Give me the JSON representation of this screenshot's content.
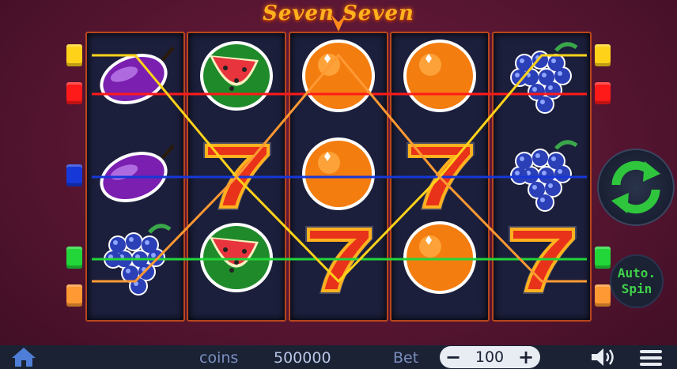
{
  "title": "Seven Seven",
  "reels": [
    [
      "plum",
      "plum",
      "grapes"
    ],
    [
      "watermelon",
      "seven",
      "watermelon"
    ],
    [
      "orange",
      "orange",
      "seven"
    ],
    [
      "orange",
      "seven",
      "orange"
    ],
    [
      "grapes",
      "grapes",
      "seven"
    ]
  ],
  "paylines": [
    {
      "color": "#ff1a1a",
      "rows": [
        0,
        0,
        0,
        0,
        0
      ]
    },
    {
      "color": "#1638d8",
      "rows": [
        1,
        1,
        1,
        1,
        1
      ]
    },
    {
      "color": "#22d63a",
      "rows": [
        2,
        2,
        2,
        2,
        2
      ]
    },
    {
      "color": "#ffd21a",
      "rows": [
        0,
        1,
        2,
        1,
        0
      ]
    },
    {
      "color": "#ff9933",
      "rows": [
        2,
        1,
        0,
        1,
        2
      ]
    }
  ],
  "controls": {
    "spin_icon": "refresh-icon",
    "auto_spin_label": "Auto.\nSpin",
    "coins_label": "coins",
    "coins_value": "500000",
    "bet_label": "Bet",
    "bet_value": "100",
    "minus_label": "−",
    "plus_label": "+"
  },
  "colors": {
    "accent_green": "#3fd14a",
    "bar": "#1a2234"
  }
}
